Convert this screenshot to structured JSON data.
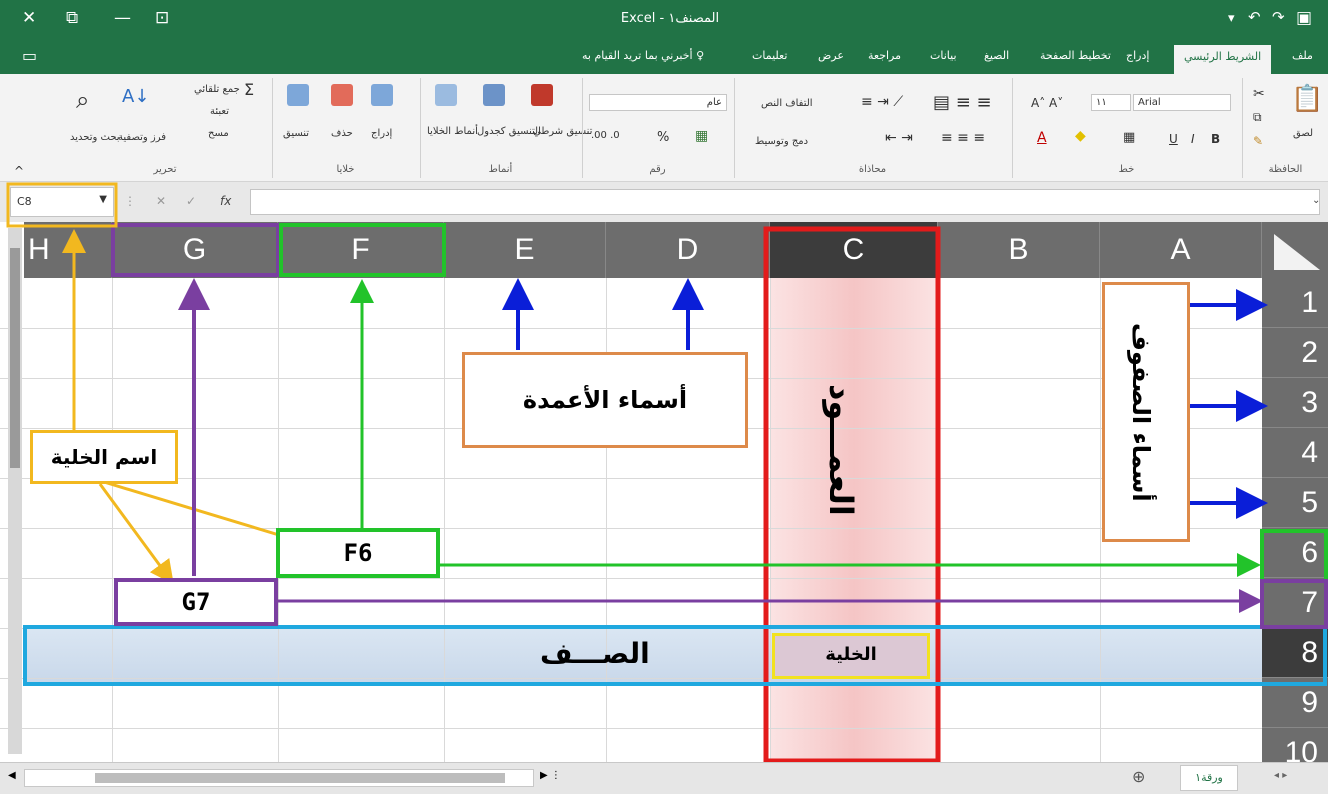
{
  "window": {
    "title": "Excel - المصنف١",
    "controls": [
      "close-icon",
      "restore-icon",
      "minimize-icon",
      "ribbon-display-icon"
    ],
    "qat": [
      "save-icon",
      "undo-icon",
      "redo-icon"
    ]
  },
  "tabs": {
    "file": "ملف",
    "home": "الشريط الرئيسي",
    "insert": "إدراج",
    "page_layout": "تخطيط الصفحة",
    "formulas": "الصيغ",
    "data": "بيانات",
    "review": "مراجعة",
    "view": "عرض",
    "help": "تعليمات",
    "tell_me": "أخبرني بما تريد القيام به"
  },
  "ribbon": {
    "clipboard": {
      "label": "الحافظة",
      "paste": "لصق"
    },
    "font": {
      "label": "خط",
      "name": "Arial",
      "size": "١١",
      "bold": "B",
      "italic": "I",
      "underline": "U"
    },
    "alignment": {
      "label": "محاذاة",
      "wrap": "التفاف النص",
      "merge": "دمج وتوسيط"
    },
    "number": {
      "label": "رقم",
      "format": "عام",
      "percent": "%"
    },
    "styles": {
      "label": "أنماط",
      "conditional": "تنسيق شرطي",
      "as_table": "التنسيق كجدول",
      "cell_styles": "أنماط الخلايا"
    },
    "cells": {
      "label": "خلايا",
      "insert": "إدراج",
      "delete": "حذف",
      "format": "تنسيق"
    },
    "editing": {
      "label": "تحرير",
      "autosum": "جمع تلقائي",
      "fill": "تعبئة",
      "clear": "مسح",
      "sort_filter": "فرز وتصفية",
      "find_select": "بحث وتحديد"
    }
  },
  "formula_bar": {
    "name_box": "C8",
    "fx": "fx"
  },
  "grid": {
    "columns": [
      "H",
      "G",
      "F",
      "E",
      "D",
      "C",
      "B",
      "A"
    ],
    "rows": [
      "1",
      "2",
      "3",
      "4",
      "5",
      "6",
      "7",
      "8",
      "9",
      "10"
    ],
    "selected_column": "C",
    "selected_row": "8"
  },
  "annotations": {
    "column_names": "أسماء الأعمدة",
    "row_names": "أسماء الصفوف",
    "column": "العمـــود",
    "row": "الصـــف",
    "cell": "الخلية",
    "cell_name": "اسم الخلية",
    "f6": "F6",
    "g7": "G7"
  },
  "sheet": {
    "tab": "ورقة١"
  },
  "colors": {
    "excel_green": "#217346",
    "column_highlight": "#e31b1b",
    "row_highlight": "#1fa8df",
    "orange_box": "#dd8a4a",
    "gold": "#f2b81f",
    "purple": "#7a3fa0",
    "green_marker": "#22c32a",
    "blue_arrow": "#0a1ed8"
  }
}
